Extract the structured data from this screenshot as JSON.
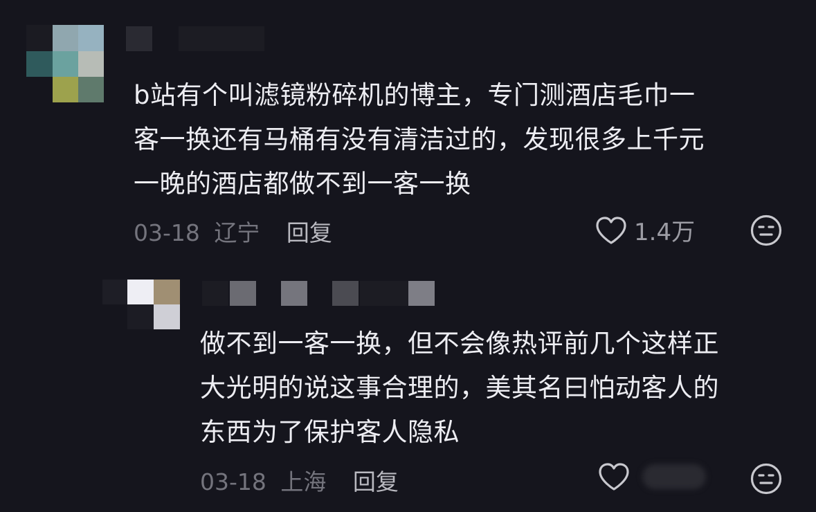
{
  "comments": [
    {
      "username": "",
      "text_lines": [
        "b站有个叫滤镜粉碎机的博主，专门测酒店毛巾一",
        "客一换还有马桶有没有清洁过的，发现很多上千元",
        "一晚的酒店都做不到一客一换"
      ],
      "date": "03-18",
      "location": "辽宁",
      "reply_label": "回复",
      "like_count": "1.4万"
    },
    {
      "username": "",
      "text_lines": [
        "做不到一客一换，但不会像热评前几个这样正",
        "大光明的说这事合理的，美其名曰怕动客人的",
        "东西为了保护客人隐私"
      ],
      "date": "03-18",
      "location": "上海",
      "reply_label": "回复",
      "like_count": ""
    }
  ],
  "icons": {
    "like": "heart-outline-icon",
    "reaction": "meh-face-icon"
  },
  "colors": {
    "background": "#15151d",
    "text": "#ededf2",
    "meta": "#74747d",
    "reply": "#b9b9c0",
    "icon": "#c8c8ce"
  }
}
